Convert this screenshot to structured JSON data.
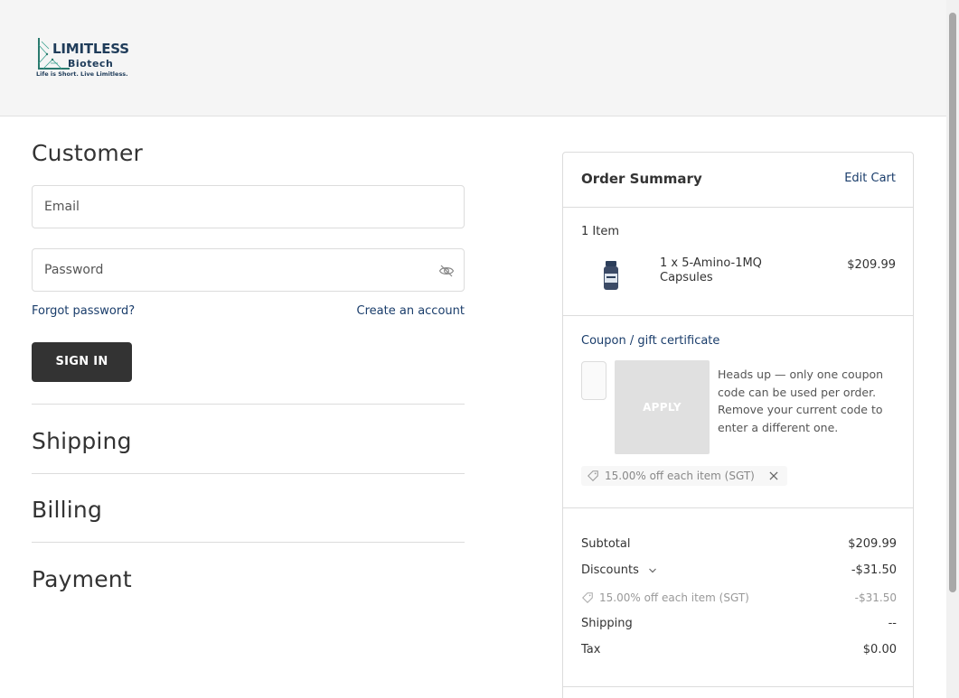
{
  "brand": {
    "name_line1": "LIMITLESS",
    "name_line2": "Biotech",
    "tagline": "Life is Short. Live Limitless."
  },
  "customer": {
    "heading": "Customer",
    "email_placeholder": "Email",
    "password_placeholder": "Password",
    "forgot_password": "Forgot password?",
    "create_account": "Create an account",
    "sign_in": "SIGN IN"
  },
  "sections": {
    "shipping": "Shipping",
    "billing": "Billing",
    "payment": "Payment"
  },
  "summary": {
    "title": "Order Summary",
    "edit_cart": "Edit Cart",
    "item_count": "1 Item",
    "items": [
      {
        "name": "1 x 5-Amino-1MQ Capsules",
        "price": "$209.99"
      }
    ],
    "coupon_label": "Coupon / gift certificate",
    "apply_label": "APPLY",
    "coupon_note": "Heads up — only one coupon code can be used per order. Remove your current code to enter a different one.",
    "applied_coupon": "15.00% off each item (SGT)",
    "totals": {
      "subtotal_label": "Subtotal",
      "subtotal_value": "$209.99",
      "discounts_label": "Discounts",
      "discounts_value": "-$31.50",
      "discount_detail_label": "15.00% off each item (SGT)",
      "discount_detail_value": "-$31.50",
      "shipping_label": "Shipping",
      "shipping_value": "--",
      "tax_label": "Tax",
      "tax_value": "$0.00"
    }
  },
  "colors": {
    "link": "#1a3d6b",
    "button_dark": "#333333",
    "apply_disabled": "#e0e0e0",
    "header_bg": "#f5f5f5"
  },
  "icons": [
    "eye-off-icon",
    "tag-icon",
    "close-icon",
    "chevron-down-icon",
    "logo-icon"
  ]
}
